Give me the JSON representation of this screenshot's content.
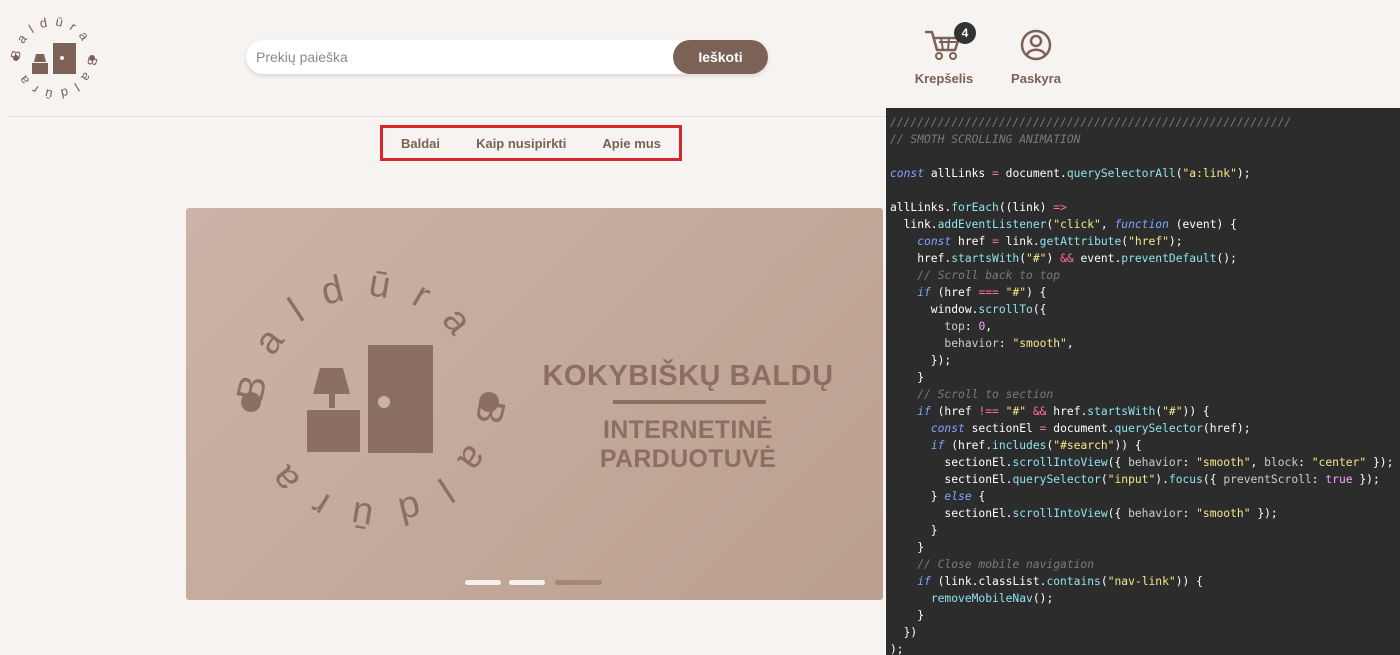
{
  "logo": {
    "brand": "Baldūra",
    "icon": "furniture-lamp-door-icon"
  },
  "search": {
    "placeholder": "Prekių paieška",
    "button_label": "Ieškoti"
  },
  "header": {
    "cart": {
      "label": "Krepšelis",
      "count": "4",
      "icon": "cart-icon"
    },
    "account": {
      "label": "Paskyra",
      "icon": "user-icon"
    }
  },
  "nav": {
    "items": [
      "Baldai",
      "Kaip nusipirkti",
      "Apie mus"
    ],
    "highlight_color": "#d7262e"
  },
  "hero": {
    "headline": "KOKYBIŠKŲ BALDŲ",
    "subheadline": "INTERNETINĖ PARDUOTUVĖ",
    "slides": 3,
    "active_slide": 3
  },
  "code": {
    "lines": [
      "///////////////////////////////////////////////////////////",
      "// SMOTH SCROLLING ANIMATION",
      "",
      "const allLinks = document.querySelectorAll(\"a:link\");",
      "",
      "allLinks.forEach((link) =>",
      "  link.addEventListener(\"click\", function (event) {",
      "    const href = link.getAttribute(\"href\");",
      "    href.startsWith(\"#\") && event.preventDefault();",
      "    // Scroll back to top",
      "    if (href === \"#\") {",
      "      window.scrollTo({",
      "        top: 0,",
      "        behavior: \"smooth\",",
      "      });",
      "    }",
      "    // Scroll to section",
      "    if (href !== \"#\" && href.startsWith(\"#\")) {",
      "      const sectionEl = document.querySelector(href);",
      "      if (href.includes(\"#search\")) {",
      "        sectionEl.scrollIntoView({ behavior: \"smooth\", block: \"center\" });",
      "        sectionEl.querySelector(\"input\").focus({ preventScroll: true });",
      "      } else {",
      "        sectionEl.scrollIntoView({ behavior: \"smooth\" });",
      "      }",
      "    }",
      "    // Close mobile navigation",
      "    if (link.classList.contains(\"nav-link\")) {",
      "      removeMobileNav();",
      "    }",
      "  })",
      ");"
    ]
  },
  "colors": {
    "brand": "#7b6156",
    "background": "#f7f3f0",
    "code_bg": "#2c2c2c"
  }
}
